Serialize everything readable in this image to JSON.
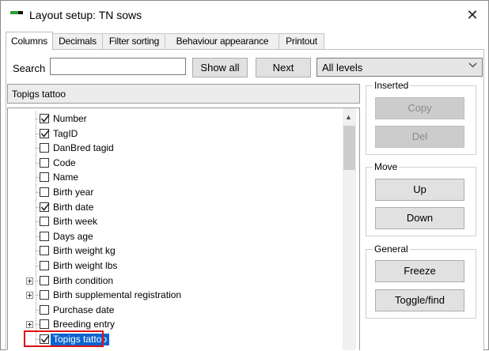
{
  "window": {
    "title": "Layout setup: TN sows",
    "close_glyph": "✕"
  },
  "tabs": [
    {
      "label": "Columns",
      "active": true
    },
    {
      "label": "Decimals",
      "active": false
    },
    {
      "label": "Filter sorting",
      "active": false
    },
    {
      "label": "Behaviour  appearance",
      "active": false
    },
    {
      "label": "Printout",
      "active": false
    }
  ],
  "search": {
    "label": "Search",
    "value": "",
    "show_all_label": "Show all",
    "next_label": "Next",
    "levels_value": "All levels"
  },
  "breadcrumb": "Topigs tattoo",
  "tree": [
    {
      "label": "Number",
      "checked": true,
      "expandable": false,
      "selected": false
    },
    {
      "label": "TagID",
      "checked": true,
      "expandable": false,
      "selected": false
    },
    {
      "label": "DanBred tagid",
      "checked": false,
      "expandable": false,
      "selected": false
    },
    {
      "label": "Code",
      "checked": false,
      "expandable": false,
      "selected": false
    },
    {
      "label": "Name",
      "checked": false,
      "expandable": false,
      "selected": false
    },
    {
      "label": "Birth year",
      "checked": false,
      "expandable": false,
      "selected": false
    },
    {
      "label": "Birth date",
      "checked": true,
      "expandable": false,
      "selected": false
    },
    {
      "label": "Birth week",
      "checked": false,
      "expandable": false,
      "selected": false
    },
    {
      "label": "Days age",
      "checked": false,
      "expandable": false,
      "selected": false
    },
    {
      "label": "Birth weight kg",
      "checked": false,
      "expandable": false,
      "selected": false
    },
    {
      "label": "Birth weight lbs",
      "checked": false,
      "expandable": false,
      "selected": false
    },
    {
      "label": "Birth condition",
      "checked": false,
      "expandable": true,
      "selected": false
    },
    {
      "label": "Birth supplemental registration",
      "checked": false,
      "expandable": true,
      "selected": false
    },
    {
      "label": "Purchase date",
      "checked": false,
      "expandable": false,
      "selected": false
    },
    {
      "label": "Breeding entry",
      "checked": false,
      "expandable": true,
      "selected": false
    },
    {
      "label": "Topigs tattoo",
      "checked": true,
      "expandable": false,
      "selected": true
    }
  ],
  "groups": {
    "inserted": {
      "title": "Inserted",
      "copy_label": "Copy",
      "del_label": "Del"
    },
    "move": {
      "title": "Move",
      "up_label": "Up",
      "down_label": "Down"
    },
    "general": {
      "title": "General",
      "freeze_label": "Freeze",
      "toggle_label": "Toggle/find"
    }
  },
  "colors": {
    "selection": "#0a64d2",
    "highlight_border": "#e01010",
    "brand_green": "#2aa02a"
  },
  "icons": {
    "scroll_up": "▲",
    "dropdown": "chevron-down-icon",
    "app": "app-icon",
    "close": "close-icon"
  }
}
